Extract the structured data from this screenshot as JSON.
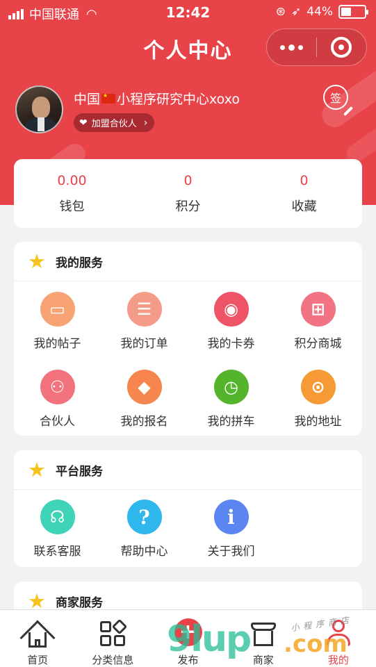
{
  "status_bar": {
    "carrier": "中国联通",
    "time": "12:42",
    "battery_text": "44%",
    "battery_level": 0.44
  },
  "nav": {
    "title": "个人中心"
  },
  "profile": {
    "name_prefix": "中国",
    "name_suffix": "小程序研究中心xoxo",
    "partner_label": "加盟合伙人",
    "sign_label": "签"
  },
  "stats": [
    {
      "value": "0.00",
      "label": "钱包"
    },
    {
      "value": "0",
      "label": "积分"
    },
    {
      "value": "0",
      "label": "收藏"
    }
  ],
  "sections": {
    "my_services": {
      "title": "我的服务",
      "items": [
        {
          "label": "我的帖子",
          "icon": "card-icon",
          "color": "#f7a373",
          "glyph": "▭"
        },
        {
          "label": "我的订单",
          "icon": "clipboard-icon",
          "color": "#f59b8a",
          "glyph": "☰"
        },
        {
          "label": "我的卡券",
          "icon": "coupon-icon",
          "color": "#ee5465",
          "glyph": "◉"
        },
        {
          "label": "积分商城",
          "icon": "gift-icon",
          "color": "#f27384",
          "glyph": "⊞"
        },
        {
          "label": "合伙人",
          "icon": "partners-icon",
          "color": "#f2737e",
          "glyph": "⚇"
        },
        {
          "label": "我的报名",
          "icon": "diamond-icon",
          "color": "#f6854e",
          "glyph": "◆"
        },
        {
          "label": "我的拼车",
          "icon": "clock-icon",
          "color": "#54b42c",
          "glyph": "◷"
        },
        {
          "label": "我的地址",
          "icon": "location-icon",
          "color": "#f59a34",
          "glyph": "⊙"
        }
      ]
    },
    "platform_services": {
      "title": "平台服务",
      "items": [
        {
          "label": "联系客服",
          "icon": "headset-icon",
          "color": "#3fd3b7",
          "glyph": "☊"
        },
        {
          "label": "帮助中心",
          "icon": "help-icon",
          "color": "#2fb7ee",
          "glyph": "?"
        },
        {
          "label": "关于我们",
          "icon": "info-icon",
          "color": "#5b86f1",
          "glyph": "i"
        }
      ]
    },
    "merchant_services": {
      "title": "商家服务"
    }
  },
  "tabbar": [
    {
      "label": "首页",
      "icon": "home-icon"
    },
    {
      "label": "分类信息",
      "icon": "category-icon"
    },
    {
      "label": "发布",
      "icon": "publish-icon"
    },
    {
      "label": "商家",
      "icon": "shop-icon"
    },
    {
      "label": "我的",
      "icon": "me-icon",
      "active": true
    }
  ],
  "watermark": {
    "text": "小程序商店",
    "logo_left": "9lup",
    "logo_right": ".com"
  },
  "colors": {
    "brand": "#e9434a",
    "star": "#f7c21b"
  }
}
